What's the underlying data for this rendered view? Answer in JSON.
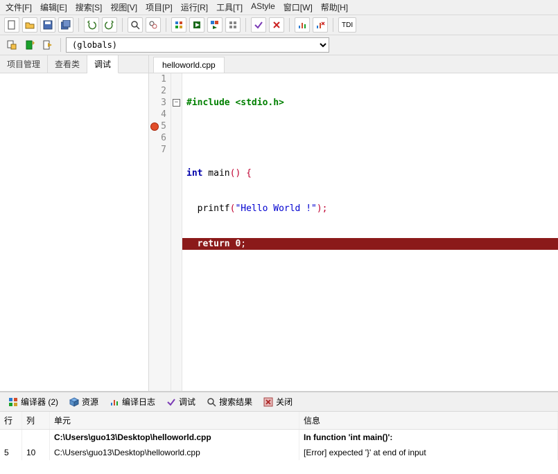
{
  "menu": {
    "file": "文件[F]",
    "edit": "编辑[E]",
    "search": "搜索[S]",
    "view": "视图[V]",
    "project": "项目[P]",
    "run": "运行[R]",
    "tools": "工具[T]",
    "astyle": "AStyle",
    "window": "窗口[W]",
    "help": "帮助[H]"
  },
  "scope_dropdown": "(globals)",
  "left_tabs": {
    "project": "项目管理",
    "classes": "查看类",
    "debug": "调试"
  },
  "file_tab": "helloworld.cpp",
  "code": {
    "l1_include": "#include <stdio.h>",
    "l3_int": "int",
    "l3_main": " main",
    "l3_paren": "() {",
    "l4_indent": "  printf",
    "l4_paren_open": "(",
    "l4_str": "\"Hello World !\"",
    "l4_paren_close": ");",
    "l5_indent_return": "  return 0",
    "l5_semi": ";"
  },
  "bottom_tabs": {
    "compiler": "编译器 (2)",
    "resources": "资源",
    "compile_log": "编译日志",
    "debug": "调试",
    "search_results": "搜索结果",
    "close": "关闭"
  },
  "msg_columns": {
    "line": "行",
    "col": "列",
    "unit": "单元",
    "info": "信息"
  },
  "msg_rows": [
    {
      "line": "",
      "col": "",
      "unit": "C:\\Users\\guo13\\Desktop\\helloworld.cpp",
      "info": "In function 'int main()':",
      "bold": true
    },
    {
      "line": "5",
      "col": "10",
      "unit": "C:\\Users\\guo13\\Desktop\\helloworld.cpp",
      "info": "[Error] expected '}' at end of input",
      "bold": false
    }
  ]
}
